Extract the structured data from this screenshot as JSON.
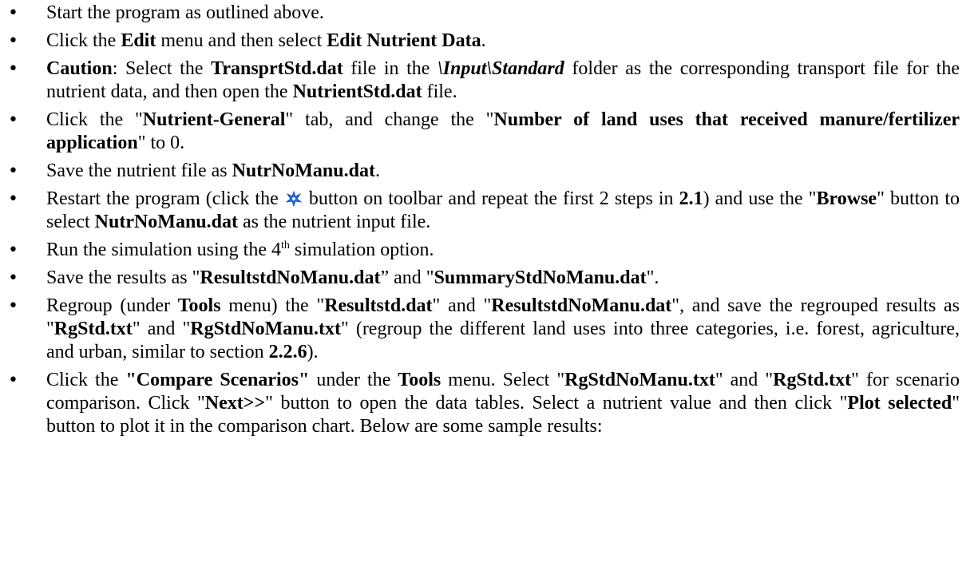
{
  "bullets": {
    "b1": {
      "text": "Start the program as outlined above."
    },
    "b2": {
      "t1": "Click the ",
      "edit": "Edit",
      "t2": " menu and then select ",
      "edit_nutrient": "Edit Nutrient Data",
      "t3": "."
    },
    "b3": {
      "caution": "Caution",
      "t1": ": Select the ",
      "file": "TransprtStd.dat",
      "t2": " file in the ",
      "folder": "\\Input\\Standard",
      "t3": " folder as the corresponding transport file for the nutrient data, and then open the ",
      "file2": "NutrientStd.dat",
      "t4": " file."
    },
    "b4": {
      "t1": "Click the \"",
      "tab": "Nutrient-General",
      "t2": "\" tab, and change the \"",
      "field": "Number of land uses that received manure/fertilizer application",
      "t3": "\" to 0."
    },
    "b5": {
      "t1": "Save the nutrient file as ",
      "file": "NutrNoManu.dat",
      "t2": "."
    },
    "b6": {
      "t1": "Restart the program (click the ",
      "t2": " button on toolbar and repeat the first 2 steps in ",
      "section": "2.1",
      "t3": ") and use the \"",
      "browse": "Browse",
      "t4": "\" button to select ",
      "file": "NutrNoManu.dat",
      "t5": " as the nutrient input file."
    },
    "b7": {
      "t1": "Run the simulation using the 4",
      "sup": "th",
      "t2": "  simulation option."
    },
    "b8": {
      "t1": "Save the results as \"",
      "file1": "ResultstdNoManu.dat",
      "t2": "” and \"",
      "file2": "SummaryStdNoManu.dat",
      "t3": "\"."
    },
    "b9": {
      "t1": "Regroup (under ",
      "tools": "Tools",
      "t2": " menu) the \"",
      "file1": "Resultstd.dat",
      "t3": "\" and \"",
      "file2": "ResultstdNoManu.dat",
      "t4": "\", and save the regrouped results as \"",
      "file3": "RgStd.txt",
      "t5": "\" and \"",
      "file4": "RgStdNoManu.txt",
      "t6": "\" (regroup the different land uses into three categories, i.e. forest, agriculture, and urban, similar to section ",
      "section": "2.2.6",
      "t7": ")."
    },
    "b10": {
      "t1": "Click the ",
      "compare": "\"Compare Scenarios\"",
      "t2": " under the ",
      "tools": "Tools",
      "t3": " menu. Select \"",
      "file1": "RgStdNoManu.txt",
      "t4": "\" and \"",
      "file2": "RgStd.txt",
      "t5": "\" for scenario comparison.  Click \"",
      "next": "Next>>",
      "t6": "\" button to open the data tables. Select a nutrient value and then click \"",
      "plot": "Plot selected",
      "t7": "\" button to plot it in the comparison chart.  Below are some sample results:"
    }
  },
  "icons": {
    "restart_icon": "restart-star-icon",
    "icon_color": "#2a6fd6"
  }
}
